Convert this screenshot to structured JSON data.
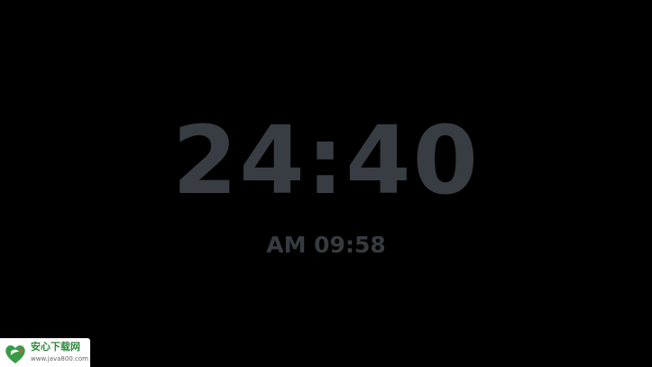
{
  "clock": {
    "main_time": "24:40",
    "secondary_time": "AM 09:58"
  },
  "watermark": {
    "logo_icon": "heart-leaf-logo-icon",
    "name": "安心下载网",
    "url": "www.java800.com",
    "brand_color": "#2f8a3c"
  },
  "colors": {
    "background": "#000000",
    "clock_text": "#373d42"
  }
}
